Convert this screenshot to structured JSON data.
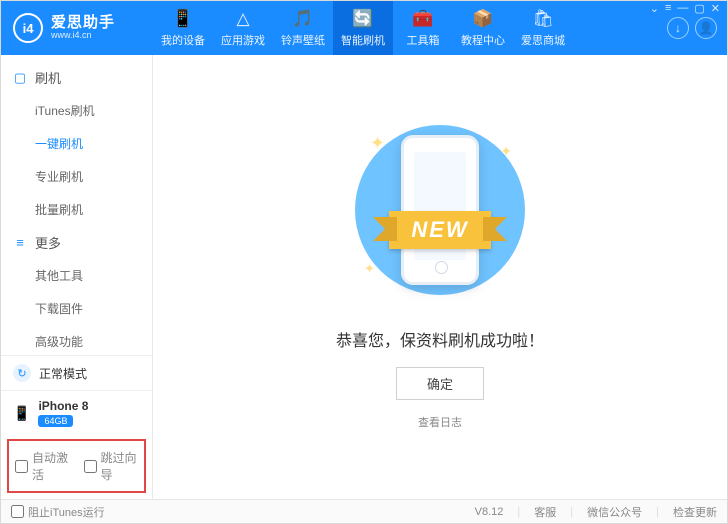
{
  "app": {
    "name": "爱思助手",
    "url": "www.i4.cn",
    "logo_letters": "i4"
  },
  "topnav": [
    {
      "icon": "📱",
      "label": "我的设备"
    },
    {
      "icon": "△",
      "label": "应用游戏"
    },
    {
      "icon": "🎵",
      "label": "铃声壁纸"
    },
    {
      "icon": "🔄",
      "label": "智能刷机"
    },
    {
      "icon": "🧰",
      "label": "工具箱"
    },
    {
      "icon": "📦",
      "label": "教程中心"
    },
    {
      "icon": "🛍",
      "label": "爱思商城"
    }
  ],
  "topnav_active_index": 3,
  "header_right": {
    "download_icon": "↓",
    "user_icon": "👤"
  },
  "window_controls": [
    "⌄",
    "≡",
    "—",
    "▢",
    "✕"
  ],
  "sidebar": {
    "group1": {
      "icon": "▢",
      "title": "刷机"
    },
    "items1": [
      "iTunes刷机",
      "一键刷机",
      "专业刷机",
      "批量刷机"
    ],
    "items1_selected_index": 1,
    "group2": {
      "icon": "≡",
      "title": "更多"
    },
    "items2": [
      "其他工具",
      "下载固件",
      "高级功能"
    ]
  },
  "status": {
    "icon": "↻",
    "label": "正常模式"
  },
  "device": {
    "icon": "📱",
    "name": "iPhone 8",
    "storage": "64GB"
  },
  "options": {
    "auto_activate": "自动激活",
    "skip_guide": "跳过向导"
  },
  "main": {
    "ribbon_text": "NEW",
    "success_msg": "恭喜您，保资料刷机成功啦！",
    "confirm_label": "确定",
    "view_log": "查看日志"
  },
  "footer": {
    "block_itunes": "阻止iTunes运行",
    "version": "V8.12",
    "support": "客服",
    "wechat": "微信公众号",
    "check_update": "检查更新"
  }
}
